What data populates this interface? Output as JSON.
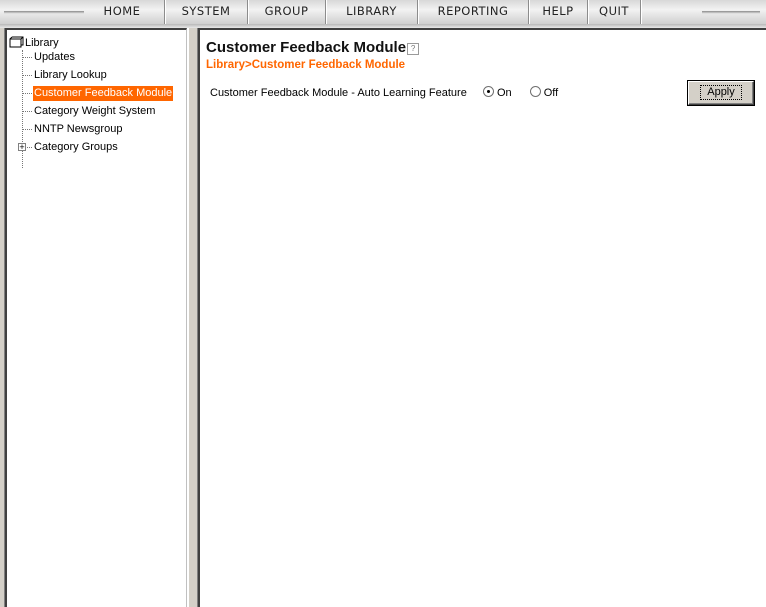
{
  "menu": {
    "items": [
      {
        "label": "HOME"
      },
      {
        "label": "SYSTEM"
      },
      {
        "label": "GROUP"
      },
      {
        "label": "LIBRARY"
      },
      {
        "label": "REPORTING"
      },
      {
        "label": "HELP"
      },
      {
        "label": "QUIT"
      }
    ]
  },
  "tree": {
    "root_label": "Library",
    "root_icon": "folder-icon",
    "items": [
      {
        "label": "Updates"
      },
      {
        "label": "Library Lookup"
      },
      {
        "label": "Customer Feedback Module",
        "selected": true
      },
      {
        "label": "Category Weight System"
      },
      {
        "label": "NNTP Newsgroup"
      },
      {
        "label": "Category Groups",
        "expandable": true,
        "expander": "+"
      }
    ]
  },
  "main": {
    "title": "Customer Feedback Module",
    "help_icon_glyph": "?",
    "breadcrumb": "Library>Customer Feedback Module",
    "setting": {
      "label": "Customer Feedback Module - Auto Learning Feature",
      "options": [
        {
          "label": "On",
          "checked": true
        },
        {
          "label": "Off",
          "checked": false
        }
      ]
    },
    "apply_label": "Apply"
  },
  "colors": {
    "accent": "#ff6600",
    "selected_text": "#ffffff"
  }
}
